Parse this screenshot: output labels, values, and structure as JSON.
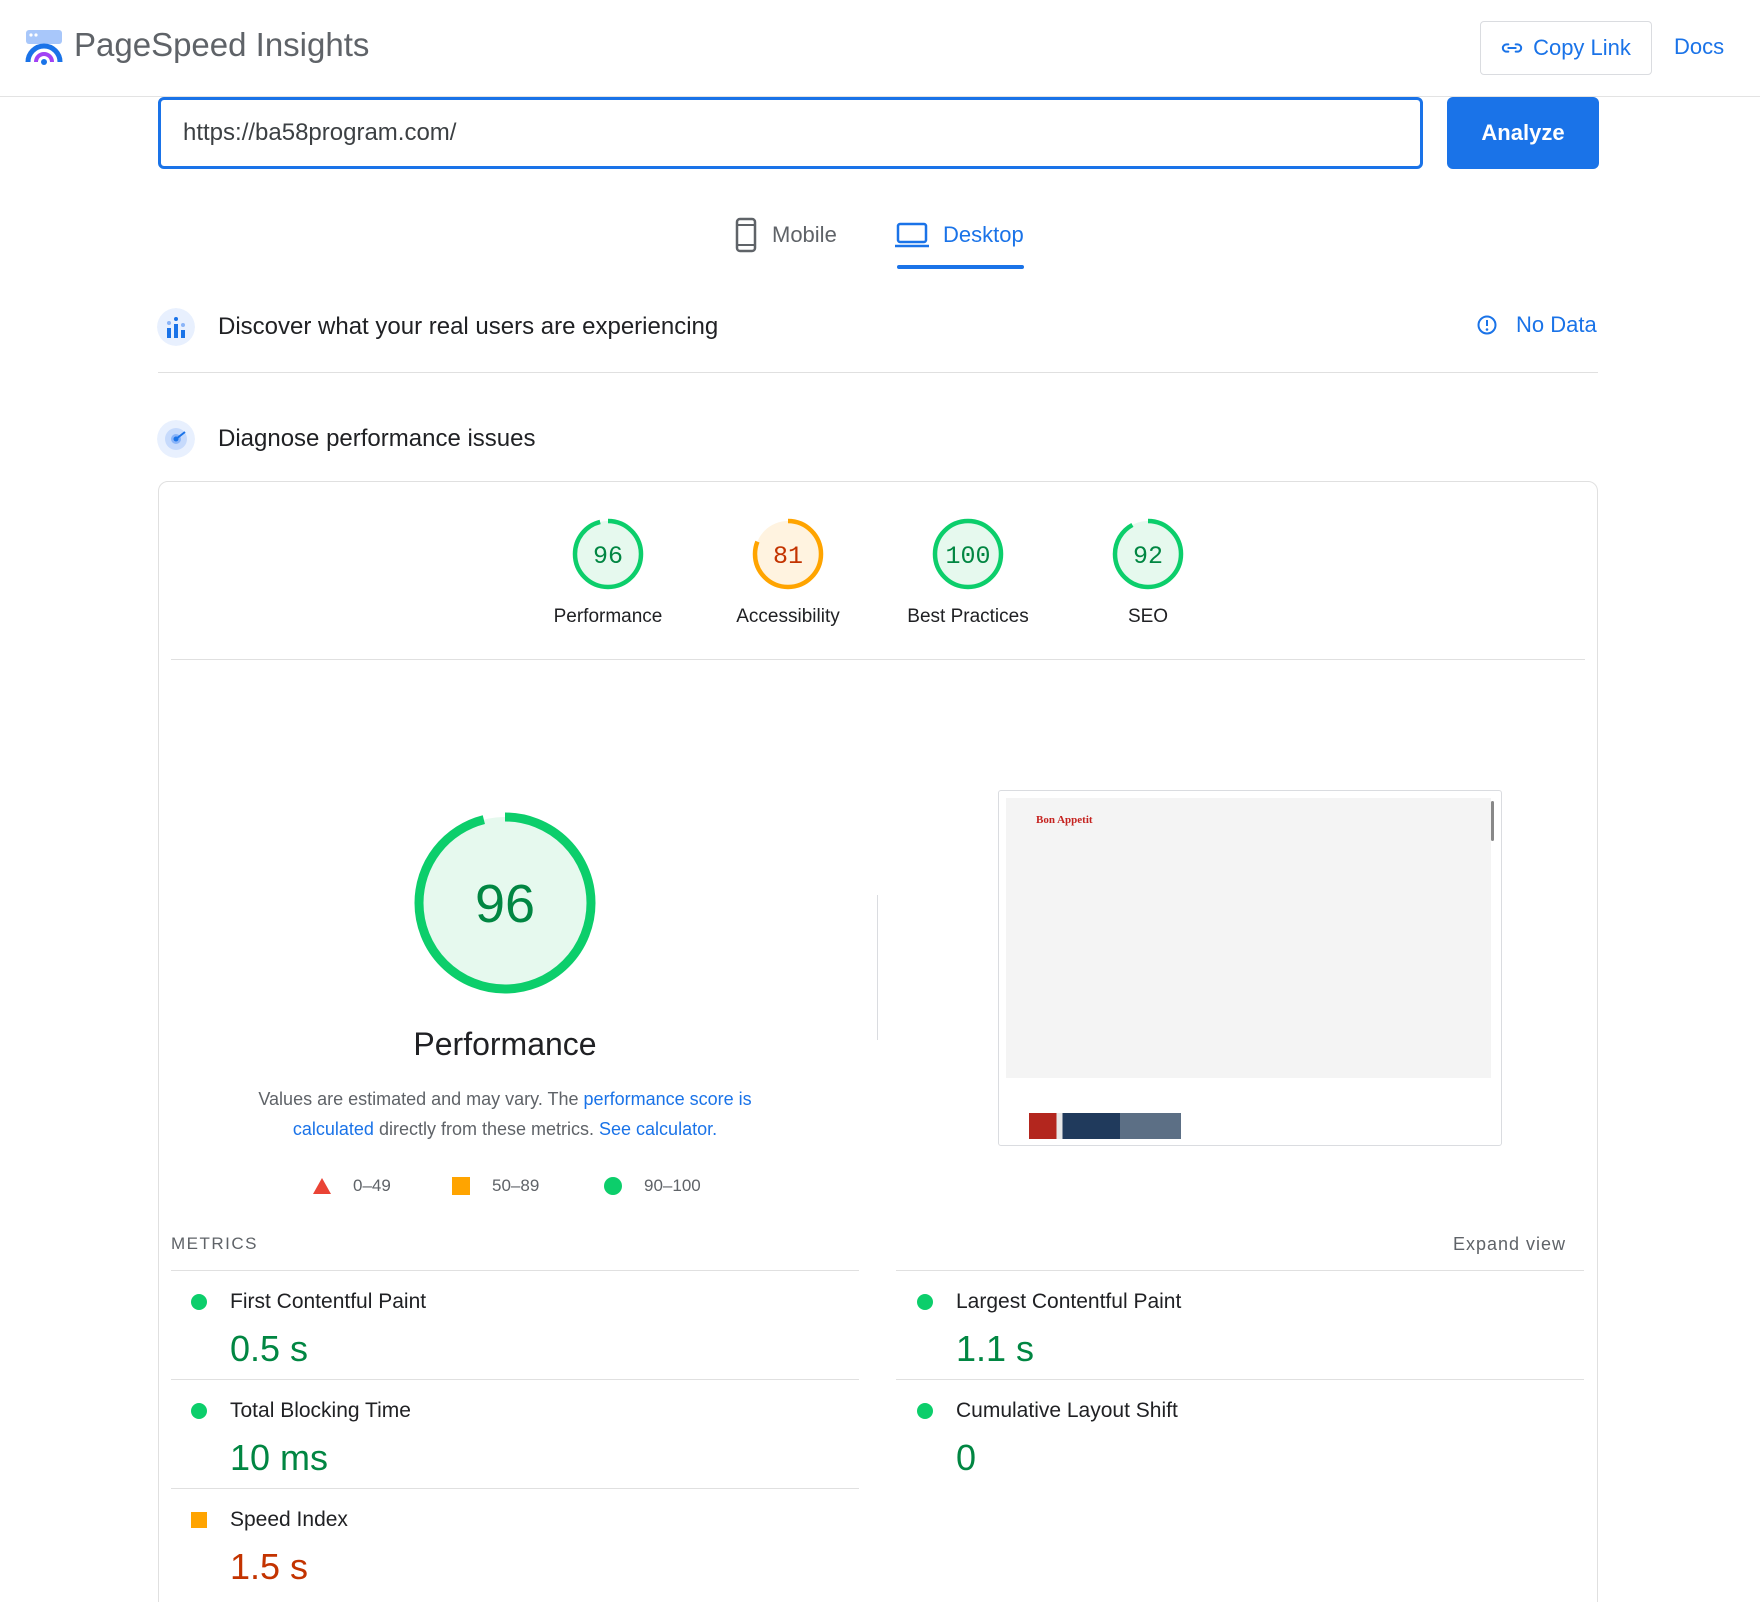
{
  "app": {
    "title": "PageSpeed Insights"
  },
  "header": {
    "copy_link_label": "Copy Link",
    "docs_label": "Docs"
  },
  "search": {
    "url_value": "https://ba58program.com/",
    "analyze_label": "Analyze"
  },
  "device_tabs": [
    {
      "label": "Mobile",
      "icon": "phone-icon",
      "selected": false
    },
    {
      "label": "Desktop",
      "icon": "laptop-icon",
      "selected": true
    }
  ],
  "field_data": {
    "title": "Discover what your real users are experiencing",
    "status": "No Data"
  },
  "lab_data": {
    "title": "Diagnose performance issues"
  },
  "scores": [
    {
      "label": "Performance",
      "value": "96",
      "status": "pass"
    },
    {
      "label": "Accessibility",
      "value": "81",
      "status": "average"
    },
    {
      "label": "Best Practices",
      "value": "100",
      "status": "pass"
    },
    {
      "label": "SEO",
      "value": "92",
      "status": "pass"
    }
  ],
  "performance": {
    "score": "96",
    "title": "Performance",
    "desc_prefix": "Values are estimated and may vary. The ",
    "desc_link1": "performance score is calculated",
    "desc_middle": " directly from these metrics. ",
    "desc_link2": "See calculator."
  },
  "legend": [
    {
      "range": "0–49",
      "shape": "triangle",
      "color": "#ea4335"
    },
    {
      "range": "50–89",
      "shape": "square",
      "color": "#ffa400"
    },
    {
      "range": "90–100",
      "shape": "circle",
      "color": "#0cce6b"
    }
  ],
  "screenshot": {
    "brand_text": "Bon Appetit"
  },
  "metrics": {
    "heading": "METRICS",
    "expand_label": "Expand view",
    "items": [
      {
        "name": "First Contentful Paint",
        "value": "0.5 s",
        "status": "pass"
      },
      {
        "name": "Largest Contentful Paint",
        "value": "1.1 s",
        "status": "pass"
      },
      {
        "name": "Total Blocking Time",
        "value": "10 ms",
        "status": "pass"
      },
      {
        "name": "Cumulative Layout Shift",
        "value": "0",
        "status": "pass"
      },
      {
        "name": "Speed Index",
        "value": "1.5 s",
        "status": "average"
      }
    ]
  },
  "colors": {
    "accent": "#1a73e8",
    "pass": "#0cce6b",
    "pass_text": "#018642",
    "average": "#ffa400",
    "average_text": "#c33300",
    "fail": "#ea4335"
  }
}
